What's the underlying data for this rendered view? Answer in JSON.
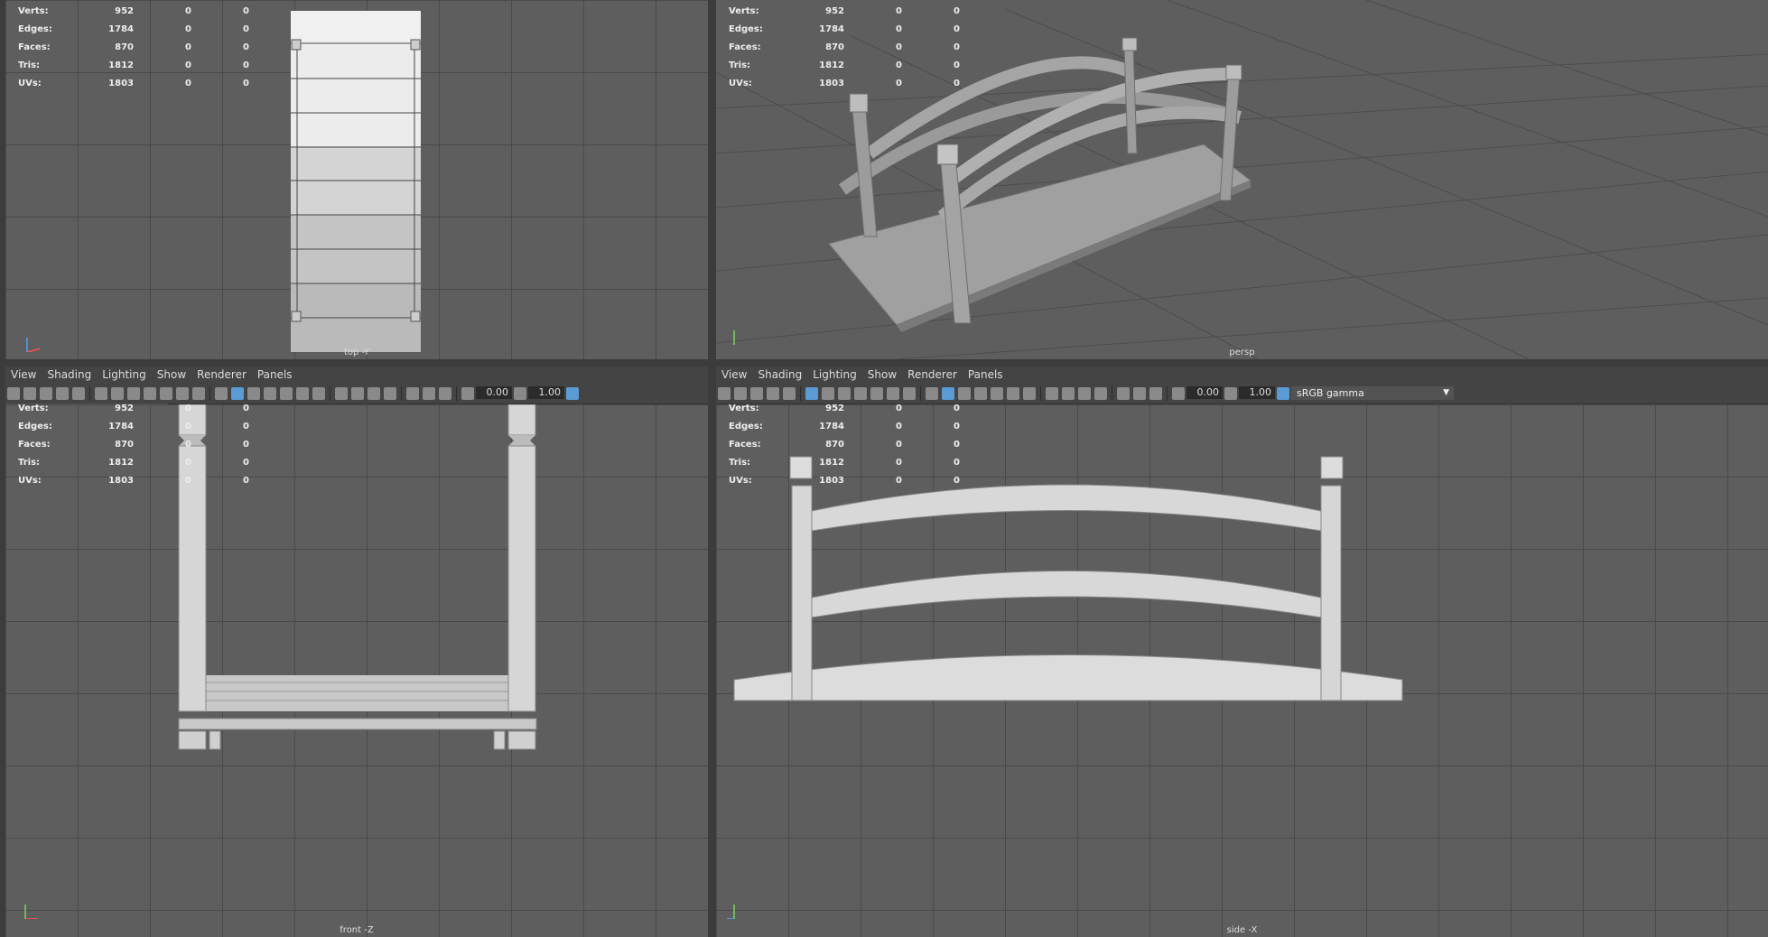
{
  "stats": {
    "rows": [
      {
        "label": "Verts:",
        "a": "952",
        "b": "0",
        "c": "0"
      },
      {
        "label": "Edges:",
        "a": "1784",
        "b": "0",
        "c": "0"
      },
      {
        "label": "Faces:",
        "a": "870",
        "b": "0",
        "c": "0"
      },
      {
        "label": "Tris:",
        "a": "1812",
        "b": "0",
        "c": "0"
      },
      {
        "label": "UVs:",
        "a": "1803",
        "b": "0",
        "c": "0"
      }
    ]
  },
  "menu": [
    "View",
    "Shading",
    "Lighting",
    "Show",
    "Renderer",
    "Panels"
  ],
  "toolbar": {
    "exposure": "0.00",
    "gamma": "1.00",
    "colorspace": "sRGB gamma"
  },
  "cameras": {
    "top": "top -Y",
    "persp": "persp",
    "front": "front -Z",
    "side": "side -X"
  },
  "colors": {
    "viewport": "#5e5e5e",
    "grid": "#4a4a4a",
    "model": "#d6d6d6",
    "highlight": "#5b9bd5"
  }
}
